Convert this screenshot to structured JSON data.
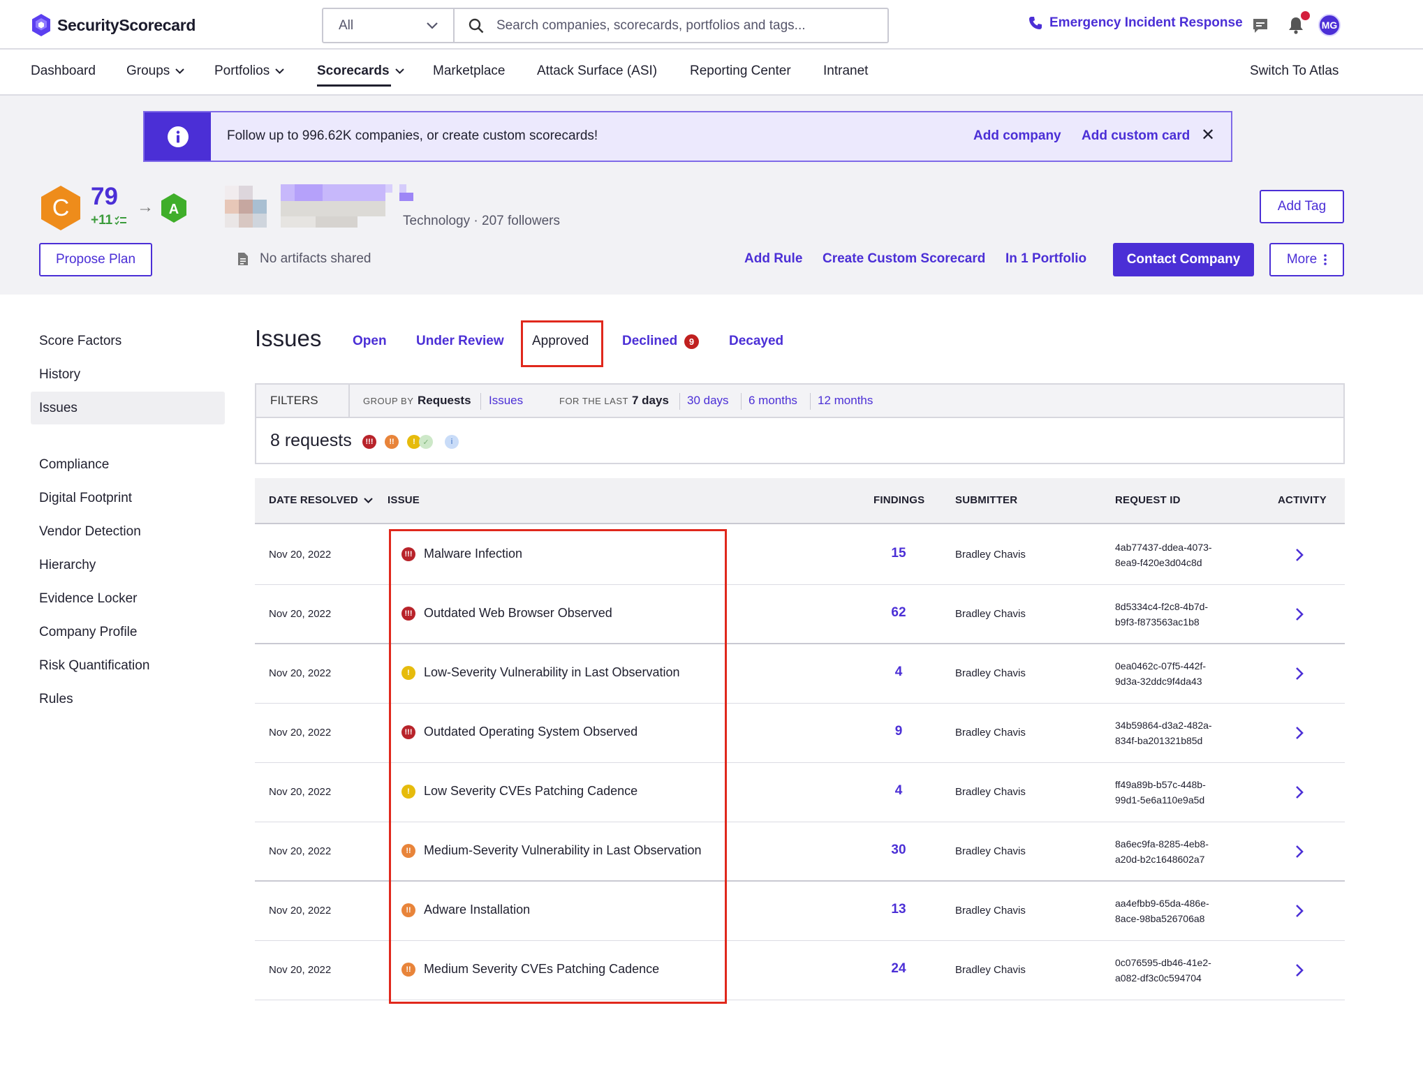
{
  "app": {
    "logo_text": "SecurityScorecard"
  },
  "search": {
    "scope": "All",
    "placeholder": "Search companies, scorecards, portfolios and tags..."
  },
  "topbar": {
    "emergency_label": "Emergency Incident Response",
    "avatar_initials": "MG"
  },
  "nav": {
    "items": [
      {
        "label": "Dashboard"
      },
      {
        "label": "Groups"
      },
      {
        "label": "Portfolios"
      },
      {
        "label": "Scorecards"
      },
      {
        "label": "Marketplace"
      },
      {
        "label": "Attack Surface (ASI)"
      },
      {
        "label": "Reporting Center"
      },
      {
        "label": "Intranet"
      }
    ],
    "active": "Scorecards",
    "switch_label": "Switch To Atlas"
  },
  "banner": {
    "text": "Follow up to 996.62K companies, or create custom scorecards!",
    "add_company": "Add company",
    "add_custom_card": "Add custom card",
    "close": "✕"
  },
  "score": {
    "grade": "C",
    "value": "79",
    "delta": "+11",
    "target_grade": "A"
  },
  "company": {
    "industry": "Technology",
    "followers": "207 followers",
    "artifacts": "No artifacts shared"
  },
  "actions": {
    "add_tag": "Add Tag",
    "propose_plan": "Propose Plan",
    "add_rule": "Add Rule",
    "create_custom": "Create Custom Scorecard",
    "in_portfolio": "In 1 Portfolio",
    "contact": "Contact Company",
    "more": "More"
  },
  "sidebar": {
    "items": [
      {
        "label": "Score Factors"
      },
      {
        "label": "History"
      },
      {
        "label": "Issues"
      },
      {
        "label": "Compliance"
      },
      {
        "label": "Digital Footprint"
      },
      {
        "label": "Vendor Detection"
      },
      {
        "label": "Hierarchy"
      },
      {
        "label": "Evidence Locker"
      },
      {
        "label": "Company Profile"
      },
      {
        "label": "Risk Quantification"
      },
      {
        "label": "Rules"
      }
    ],
    "active": "Issues"
  },
  "issues": {
    "title": "Issues",
    "tabs": [
      {
        "label": "Open"
      },
      {
        "label": "Under Review"
      },
      {
        "label": "Approved"
      },
      {
        "label": "Declined",
        "badge": "9"
      },
      {
        "label": "Decayed"
      }
    ],
    "active_tab": "Approved"
  },
  "filters": {
    "label": "FILTERS",
    "group_by_label": "GROUP BY",
    "group_by_selected": "Requests",
    "group_by_other": "Issues",
    "period_label": "FOR THE LAST",
    "periods": [
      "7 days",
      "30 days",
      "6 months",
      "12 months"
    ],
    "period_selected": "7 days",
    "requests_count": "8 requests"
  },
  "colors": {
    "accent": "#4b2fd6",
    "high": "#b8232a",
    "medium": "#e8843a",
    "low": "#e6bb0c",
    "positive": "#cde8c8",
    "info": "#c9dcf8",
    "grade_c": "#ee8c1b",
    "grade_a": "#3fae2a",
    "highlight": "#e0281c"
  },
  "table": {
    "headers": {
      "date": "DATE RESOLVED",
      "issue": "ISSUE",
      "findings": "FINDINGS",
      "submitter": "SUBMITTER",
      "request_id": "REQUEST ID",
      "activity": "ACTIVITY"
    },
    "rows": [
      {
        "date": "Nov 20, 2022",
        "severity": "high",
        "issue": "Malware Infection",
        "findings": "15",
        "submitter": "Bradley Chavis",
        "req1": "4ab77437-ddea-4073-",
        "req2": "8ea9-f420e3d04c8d"
      },
      {
        "date": "Nov 20, 2022",
        "severity": "high",
        "issue": "Outdated Web Browser Observed",
        "findings": "62",
        "submitter": "Bradley Chavis",
        "req1": "8d5334c4-f2c8-4b7d-",
        "req2": "b9f3-f873563ac1b8"
      },
      {
        "date": "Nov 20, 2022",
        "severity": "low",
        "issue": "Low-Severity Vulnerability in Last Observation",
        "findings": "4",
        "submitter": "Bradley Chavis",
        "req1": "0ea0462c-07f5-442f-",
        "req2": "9d3a-32ddc9f4da43"
      },
      {
        "date": "Nov 20, 2022",
        "severity": "high",
        "issue": "Outdated Operating System Observed",
        "findings": "9",
        "submitter": "Bradley Chavis",
        "req1": "34b59864-d3a2-482a-",
        "req2": "834f-ba201321b85d"
      },
      {
        "date": "Nov 20, 2022",
        "severity": "low",
        "issue": "Low Severity CVEs Patching Cadence",
        "findings": "4",
        "submitter": "Bradley Chavis",
        "req1": "ff49a89b-b57c-448b-",
        "req2": "99d1-5e6a110e9a5d"
      },
      {
        "date": "Nov 20, 2022",
        "severity": "medium",
        "issue": "Medium-Severity Vulnerability in Last Observation",
        "findings": "30",
        "submitter": "Bradley Chavis",
        "req1": "8a6ec9fa-8285-4eb8-",
        "req2": "a20d-b2c1648602a7"
      },
      {
        "date": "Nov 20, 2022",
        "severity": "medium",
        "issue": "Adware Installation",
        "findings": "13",
        "submitter": "Bradley Chavis",
        "req1": "aa4efbb9-65da-486e-",
        "req2": "8ace-98ba526706a8"
      },
      {
        "date": "Nov 20, 2022",
        "severity": "medium",
        "issue": "Medium Severity CVEs Patching Cadence",
        "findings": "24",
        "submitter": "Bradley Chavis",
        "req1": "0c076595-db46-41e2-",
        "req2": "a082-df3c0c594704"
      }
    ]
  }
}
